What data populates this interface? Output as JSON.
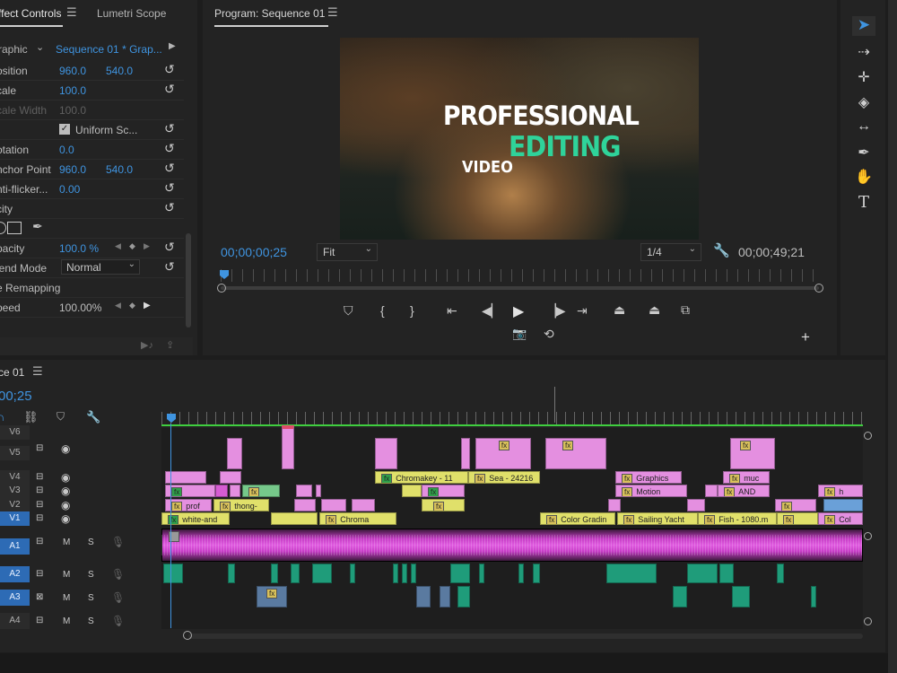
{
  "effect_panel": {
    "tabs": [
      "ffect Controls",
      "Lumetri Scope"
    ],
    "clip_name": "raphic",
    "sequence_label": "Sequence 01 * Grap...",
    "rows": [
      {
        "label": "osition",
        "v1": "960.0",
        "v2": "540.0"
      },
      {
        "label": "cale",
        "v1": "100.0"
      },
      {
        "label": "cale Width",
        "v1": "100.0"
      },
      {
        "label": "",
        "v1": "Uniform Sc..."
      },
      {
        "label": "otation",
        "v1": "0.0"
      },
      {
        "label": "nchor Point",
        "v1": "960.0",
        "v2": "540.0"
      },
      {
        "label": "nti-flicker...",
        "v1": "0.00"
      },
      {
        "label": "city"
      },
      {
        "label": ""
      },
      {
        "label": "pacity",
        "v1": "100.0 %"
      },
      {
        "label": "lend Mode",
        "v1": "Normal"
      },
      {
        "label": "e Remapping"
      },
      {
        "label": "peed",
        "v1": "100.00%"
      }
    ]
  },
  "program": {
    "title": "Program: Sequence 01",
    "video_text": {
      "line1": "PROFESSIONAL",
      "line2": "EDITING",
      "line3": "VIDEO"
    },
    "timecode": "00;00;00;25",
    "fit": "Fit",
    "resolution": "1/4",
    "duration": "00;00;49;21"
  },
  "timeline": {
    "title": "ce 01",
    "timecode": "00;25",
    "video_tracks": [
      "V6",
      "V5",
      "V4",
      "V3",
      "V2",
      "V1"
    ],
    "audio_tracks": [
      "A1",
      "A2",
      "A3",
      "A4"
    ],
    "audio_letters": {
      "m": "M",
      "s": "S"
    },
    "clips": {
      "chromakey": "Chromakey - 11",
      "sea": "Sea - 24216",
      "graphics": "Graphics",
      "muc": "muc",
      "motion": "Motion",
      "and": "AND",
      "prof": "prof",
      "thong": "thong-",
      "white": "white-and",
      "chroma": "Chroma",
      "color": "Color Gradin",
      "sailing": "Sailing Yacht",
      "fish": "Fish - 1080.m",
      "col": "Col",
      "h": "h",
      "fx": "fx"
    }
  },
  "colors": {
    "accent": "#3f94e0",
    "video_clip_pink": "#e48fe0",
    "video_clip_yellow": "#e0e06a",
    "audio_clip": "#1f9c7a",
    "playhead": "#3f94e0"
  }
}
